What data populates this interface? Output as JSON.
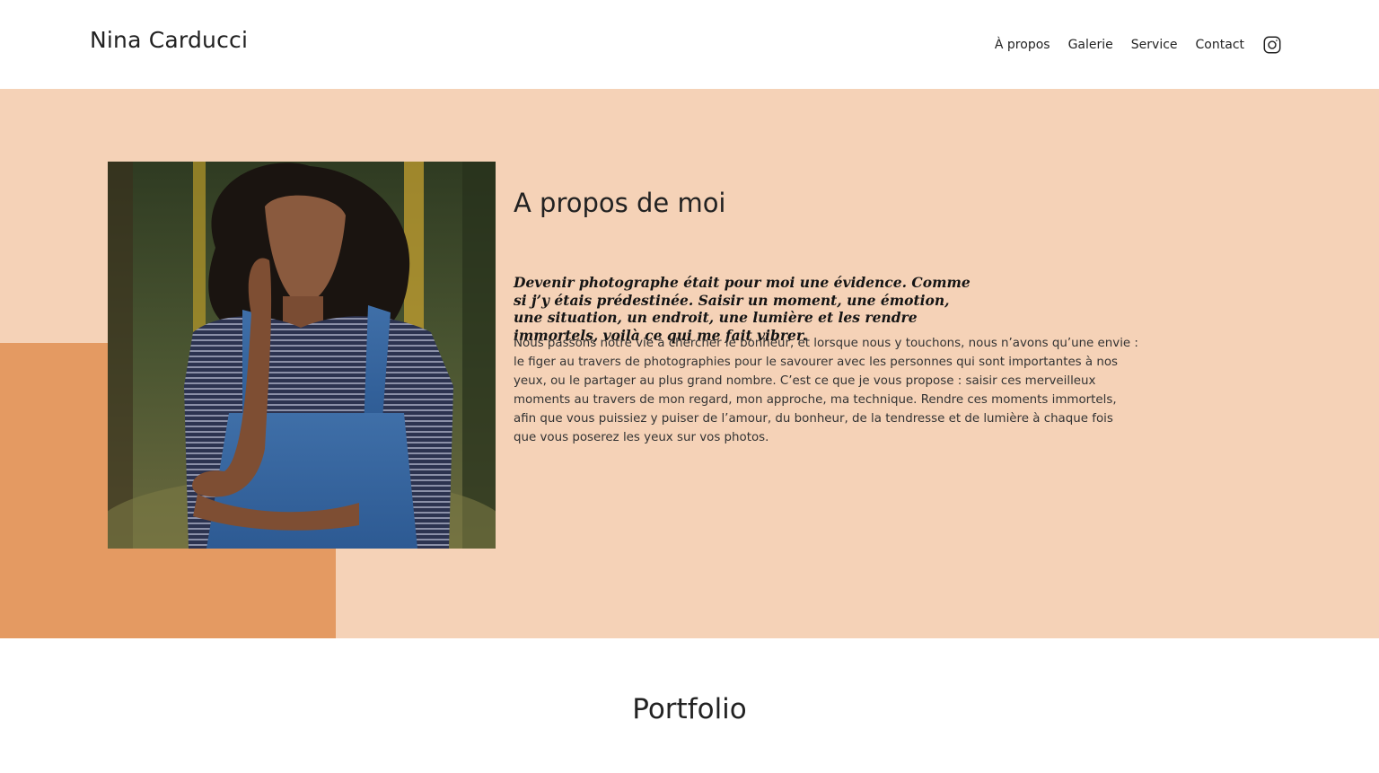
{
  "header": {
    "brand": "Nina Carducci",
    "nav": [
      {
        "label": "À propos"
      },
      {
        "label": "Galerie"
      },
      {
        "label": "Service"
      },
      {
        "label": "Contact"
      }
    ],
    "social_icon": "instagram-icon"
  },
  "about": {
    "title": "A propos de moi",
    "quote": "Devenir photographe était pour moi une évidence. Comme si j’y étais prédestinée. Saisir un moment, une émotion, une situation, un endroit, une lumière et les rendre immortels, voilà ce qui me fait vibrer.",
    "text": "Nous passons notre vie à chercher le bonheur, et lorsque nous y touchons, nous n’avons qu’une envie : le figer au travers de photographies pour le savourer avec les personnes qui sont importantes à nos yeux, ou le partager au plus grand nombre. C’est ce que je vous propose : saisir ces merveilleux moments au travers de mon regard, mon approche, ma technique. Rendre ces moments immortels, afin que vous puissiez y puiser de l’amour, du bonheur, de la tendresse et de lumière à chaque fois que vous poserez les yeux sur vos photos.",
    "background_color": "#f5d2b7",
    "accent_color": "#e49a62"
  },
  "portfolio": {
    "title": "Portfolio"
  }
}
